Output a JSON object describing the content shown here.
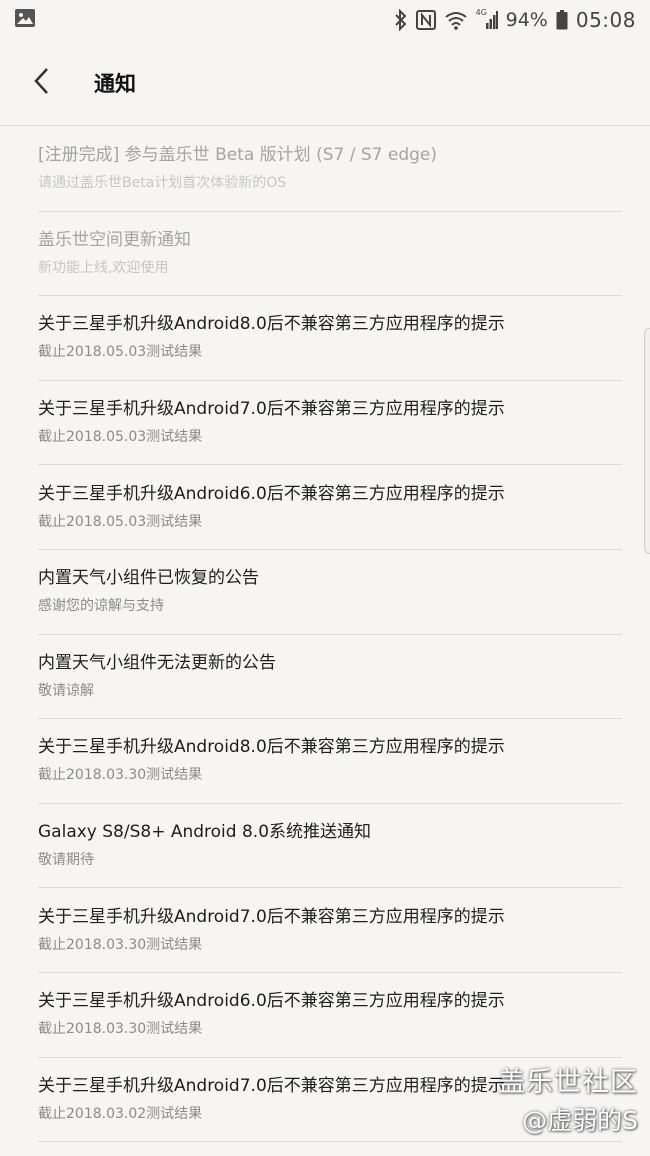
{
  "status_bar": {
    "battery": "94%",
    "time": "05:08",
    "network": "4G"
  },
  "header": {
    "title": "通知"
  },
  "notifications": [
    {
      "title": "[注册完成] 参与盖乐世 Beta 版计划 (S7 / S7 edge)",
      "subtitle": "请通过盖乐世Beta计划首次体验新的OS",
      "read": true
    },
    {
      "title": "盖乐世空间更新通知",
      "subtitle": "新功能上线,欢迎使用",
      "read": true
    },
    {
      "title": "关于三星手机升级Android8.0后不兼容第三方应用程序的提示",
      "subtitle": "截止2018.05.03测试结果",
      "read": false
    },
    {
      "title": "关于三星手机升级Android7.0后不兼容第三方应用程序的提示",
      "subtitle": "截止2018.05.03测试结果",
      "read": false
    },
    {
      "title": "关于三星手机升级Android6.0后不兼容第三方应用程序的提示",
      "subtitle": "截止2018.05.03测试结果",
      "read": false
    },
    {
      "title": "内置天气小组件已恢复的公告",
      "subtitle": "感谢您的谅解与支持",
      "read": false
    },
    {
      "title": "内置天气小组件无法更新的公告",
      "subtitle": "敬请谅解",
      "read": false
    },
    {
      "title": "关于三星手机升级Android8.0后不兼容第三方应用程序的提示",
      "subtitle": "截止2018.03.30测试结果",
      "read": false
    },
    {
      "title": "Galaxy S8/S8+ Android 8.0系统推送通知",
      "subtitle": "敬请期待",
      "read": false
    },
    {
      "title": "关于三星手机升级Android7.0后不兼容第三方应用程序的提示",
      "subtitle": "截止2018.03.30测试结果",
      "read": false
    },
    {
      "title": "关于三星手机升级Android6.0后不兼容第三方应用程序的提示",
      "subtitle": "截止2018.03.30测试结果",
      "read": false
    },
    {
      "title": "关于三星手机升级Android7.0后不兼容第三方应用程序的提示",
      "subtitle": "截止2018.03.02测试结果",
      "read": false
    }
  ],
  "watermark": {
    "line1": "盖乐世社区",
    "line2": "@虚弱的S"
  }
}
